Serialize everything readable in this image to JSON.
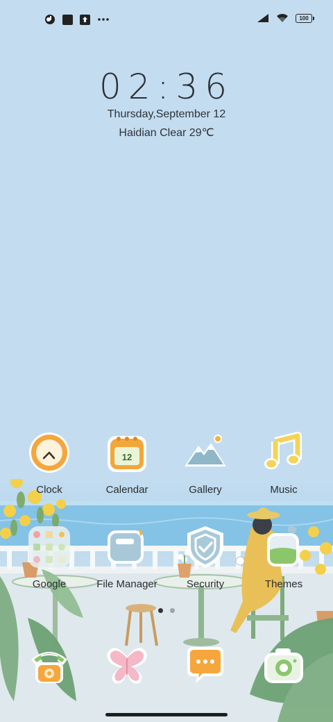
{
  "status_bar": {
    "left_icons": [
      "notification-app-icon",
      "square-notification-icon",
      "upload-notification-icon",
      "more-notifications-icon"
    ],
    "right_icons": [
      "cellular-signal-icon",
      "wifi-icon",
      "battery-icon"
    ],
    "battery_level": "100"
  },
  "clock_widget": {
    "time": "02:36",
    "date": "Thursday,September 12",
    "weather": "Haidian Clear 29℃"
  },
  "apps": {
    "row1": [
      {
        "label": "Clock",
        "icon": "clock-icon"
      },
      {
        "label": "Calendar",
        "icon": "calendar-icon",
        "icon_text": "12"
      },
      {
        "label": "Gallery",
        "icon": "gallery-icon"
      },
      {
        "label": "Music",
        "icon": "music-icon"
      }
    ],
    "row2": [
      {
        "label": "Google",
        "icon": "google-folder-icon"
      },
      {
        "label": "File Manager",
        "icon": "file-manager-icon"
      },
      {
        "label": "Security",
        "icon": "security-shield-icon"
      },
      {
        "label": "Themes",
        "icon": "themes-icon"
      }
    ]
  },
  "page_indicator": {
    "pages": 2,
    "active": 1
  },
  "dock": [
    {
      "icon": "phone-icon"
    },
    {
      "icon": "butterfly-icon"
    },
    {
      "icon": "messages-icon"
    },
    {
      "icon": "camera-icon"
    }
  ],
  "colors": {
    "sky": "#c3dcf0",
    "sea": "#7fc0e6",
    "icon_orange": "#f2a33a",
    "icon_yellow": "#f7d45a",
    "icon_blue": "#a9c9d8",
    "icon_green": "#8cc66b",
    "icon_pink": "#f4b8c6"
  }
}
